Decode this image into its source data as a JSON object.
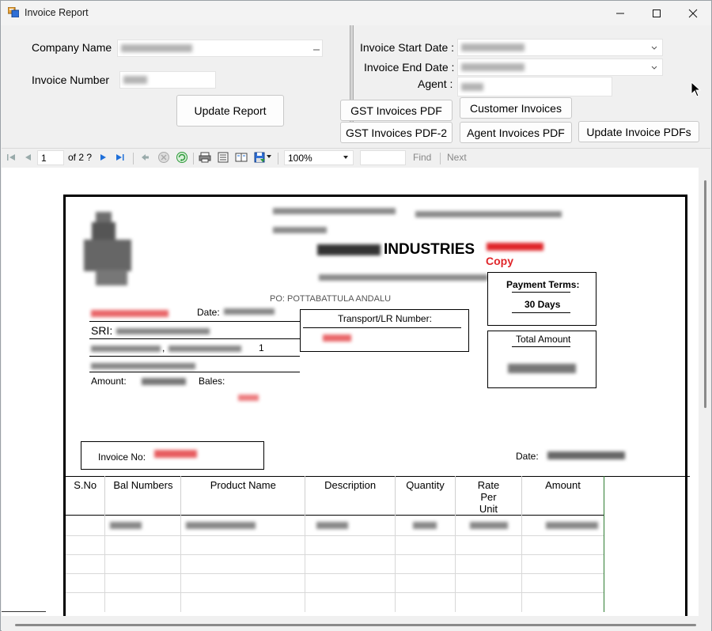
{
  "window": {
    "title": "Invoice Report"
  },
  "params": {
    "company_name_label": "Company Name",
    "invoice_number_label": "Invoice Number",
    "update_report_label": "Update Report",
    "invoice_start_label": "Invoice Start Date :",
    "invoice_end_label": "Invoice End Date :",
    "agent_label": "Agent :"
  },
  "buttons": {
    "gst_pdf": "GST Invoices PDF",
    "customer_invoices": "Customer Invoices",
    "gst_pdf2": "GST Invoices PDF-2",
    "agent_invoices_pdf": "Agent Invoices PDF",
    "update_invoice_pdfs": "Update Invoice PDFs"
  },
  "toolbar": {
    "page": "1",
    "of_pages": "of  2 ?",
    "zoom": "100%",
    "find": "Find",
    "next": "Next"
  },
  "report": {
    "company_suffix": "INDUSTRIES",
    "copy_label": "Copy",
    "address_tail": "01",
    "po_line": "PO: POTTABATTULA ANDALU",
    "payment_terms_label": "Payment Terms:",
    "payment_terms_value": "30 Days",
    "total_amount_label": "Total Amount",
    "date_label": "Date:",
    "transport_label": "Transport/LR Number:",
    "sri_label": "SRI:",
    "address_suffix": ",",
    "address_num": "1",
    "amount_label": "Amount:",
    "bales_label": "Bales:",
    "invoice_no_label": "Invoice No:",
    "date2_label": "Date:",
    "columns": [
      "S.No",
      "Bal Numbers",
      "Product Name",
      "Description",
      "Quantity",
      "Rate Per Unit",
      "Amount"
    ]
  },
  "colors": {
    "accent_red": "#e0262a",
    "link_blue": "#1e6fd9"
  }
}
